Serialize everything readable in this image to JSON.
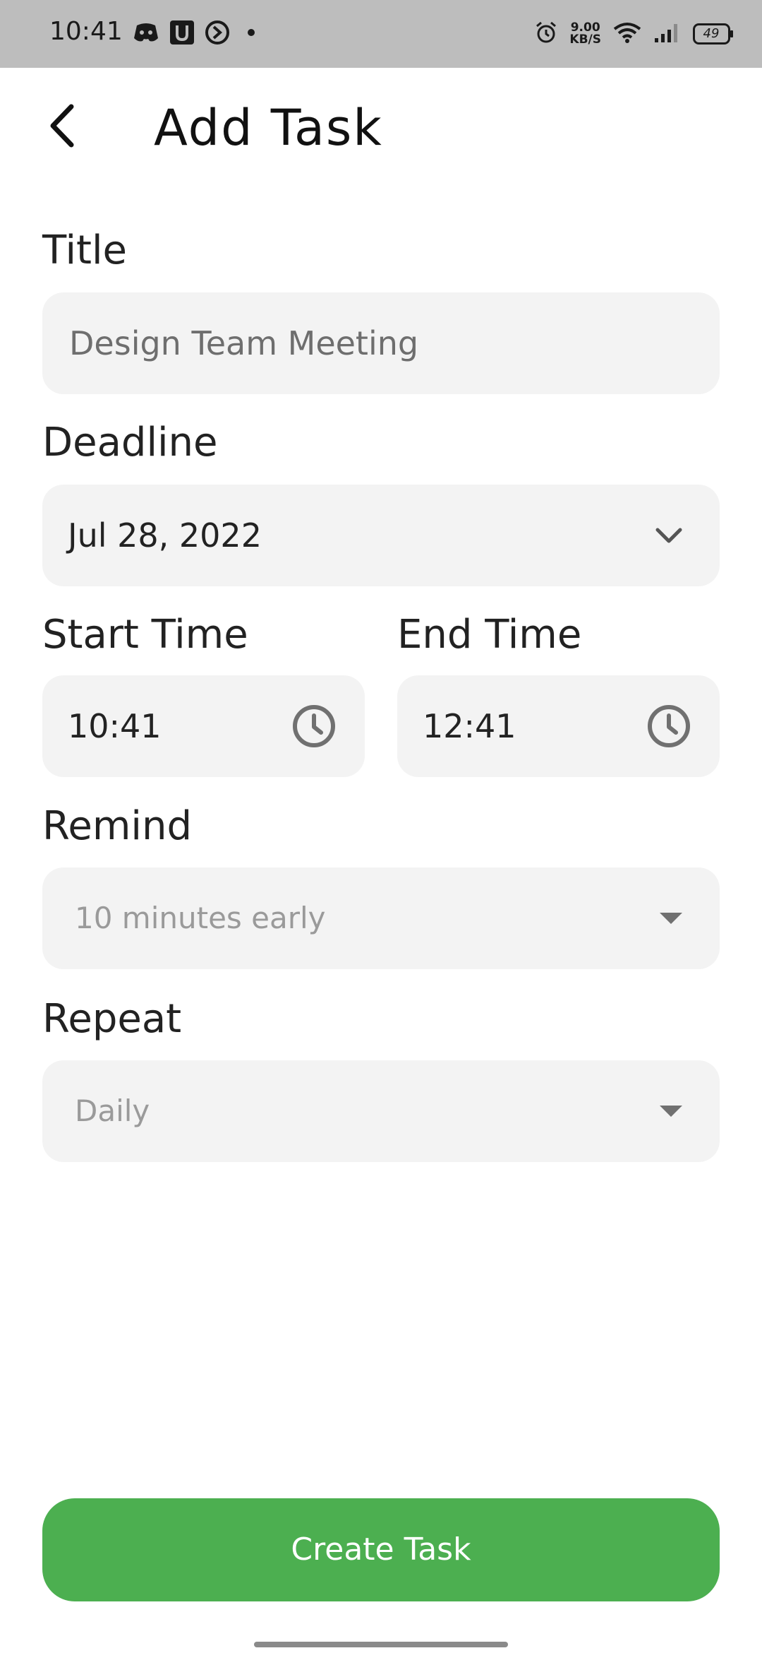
{
  "status_bar": {
    "time": "10:41",
    "network_speed_value": "9.00",
    "network_speed_unit": "KB/S",
    "battery_level": "49",
    "icons": [
      "discord-icon",
      "u-app-icon",
      "media-app-icon",
      "notification-dot-icon",
      "alarm-icon",
      "wifi-icon",
      "cellular-signal-icon",
      "battery-icon"
    ]
  },
  "header": {
    "back_icon": "chevron-left-icon",
    "title": "Add Task"
  },
  "form": {
    "title_field": {
      "label": "Title",
      "placeholder": "Design Team Meeting"
    },
    "deadline_field": {
      "label": "Deadline",
      "value": "Jul 28, 2022",
      "icon": "chevron-down-icon"
    },
    "start_time_field": {
      "label": "Start Time",
      "value": "10:41",
      "icon": "clock-icon"
    },
    "end_time_field": {
      "label": "End Time",
      "value": "12:41",
      "icon": "clock-icon"
    },
    "remind_field": {
      "label": "Remind",
      "value": "10 minutes early",
      "icon": "caret-down-icon"
    },
    "repeat_field": {
      "label": "Repeat",
      "value": "Daily",
      "icon": "caret-down-icon"
    }
  },
  "actions": {
    "create_label": "Create Task"
  },
  "colors": {
    "accent": "#4caf50",
    "field_background": "#f3f3f3",
    "status_bar": "#bdbdbd"
  }
}
